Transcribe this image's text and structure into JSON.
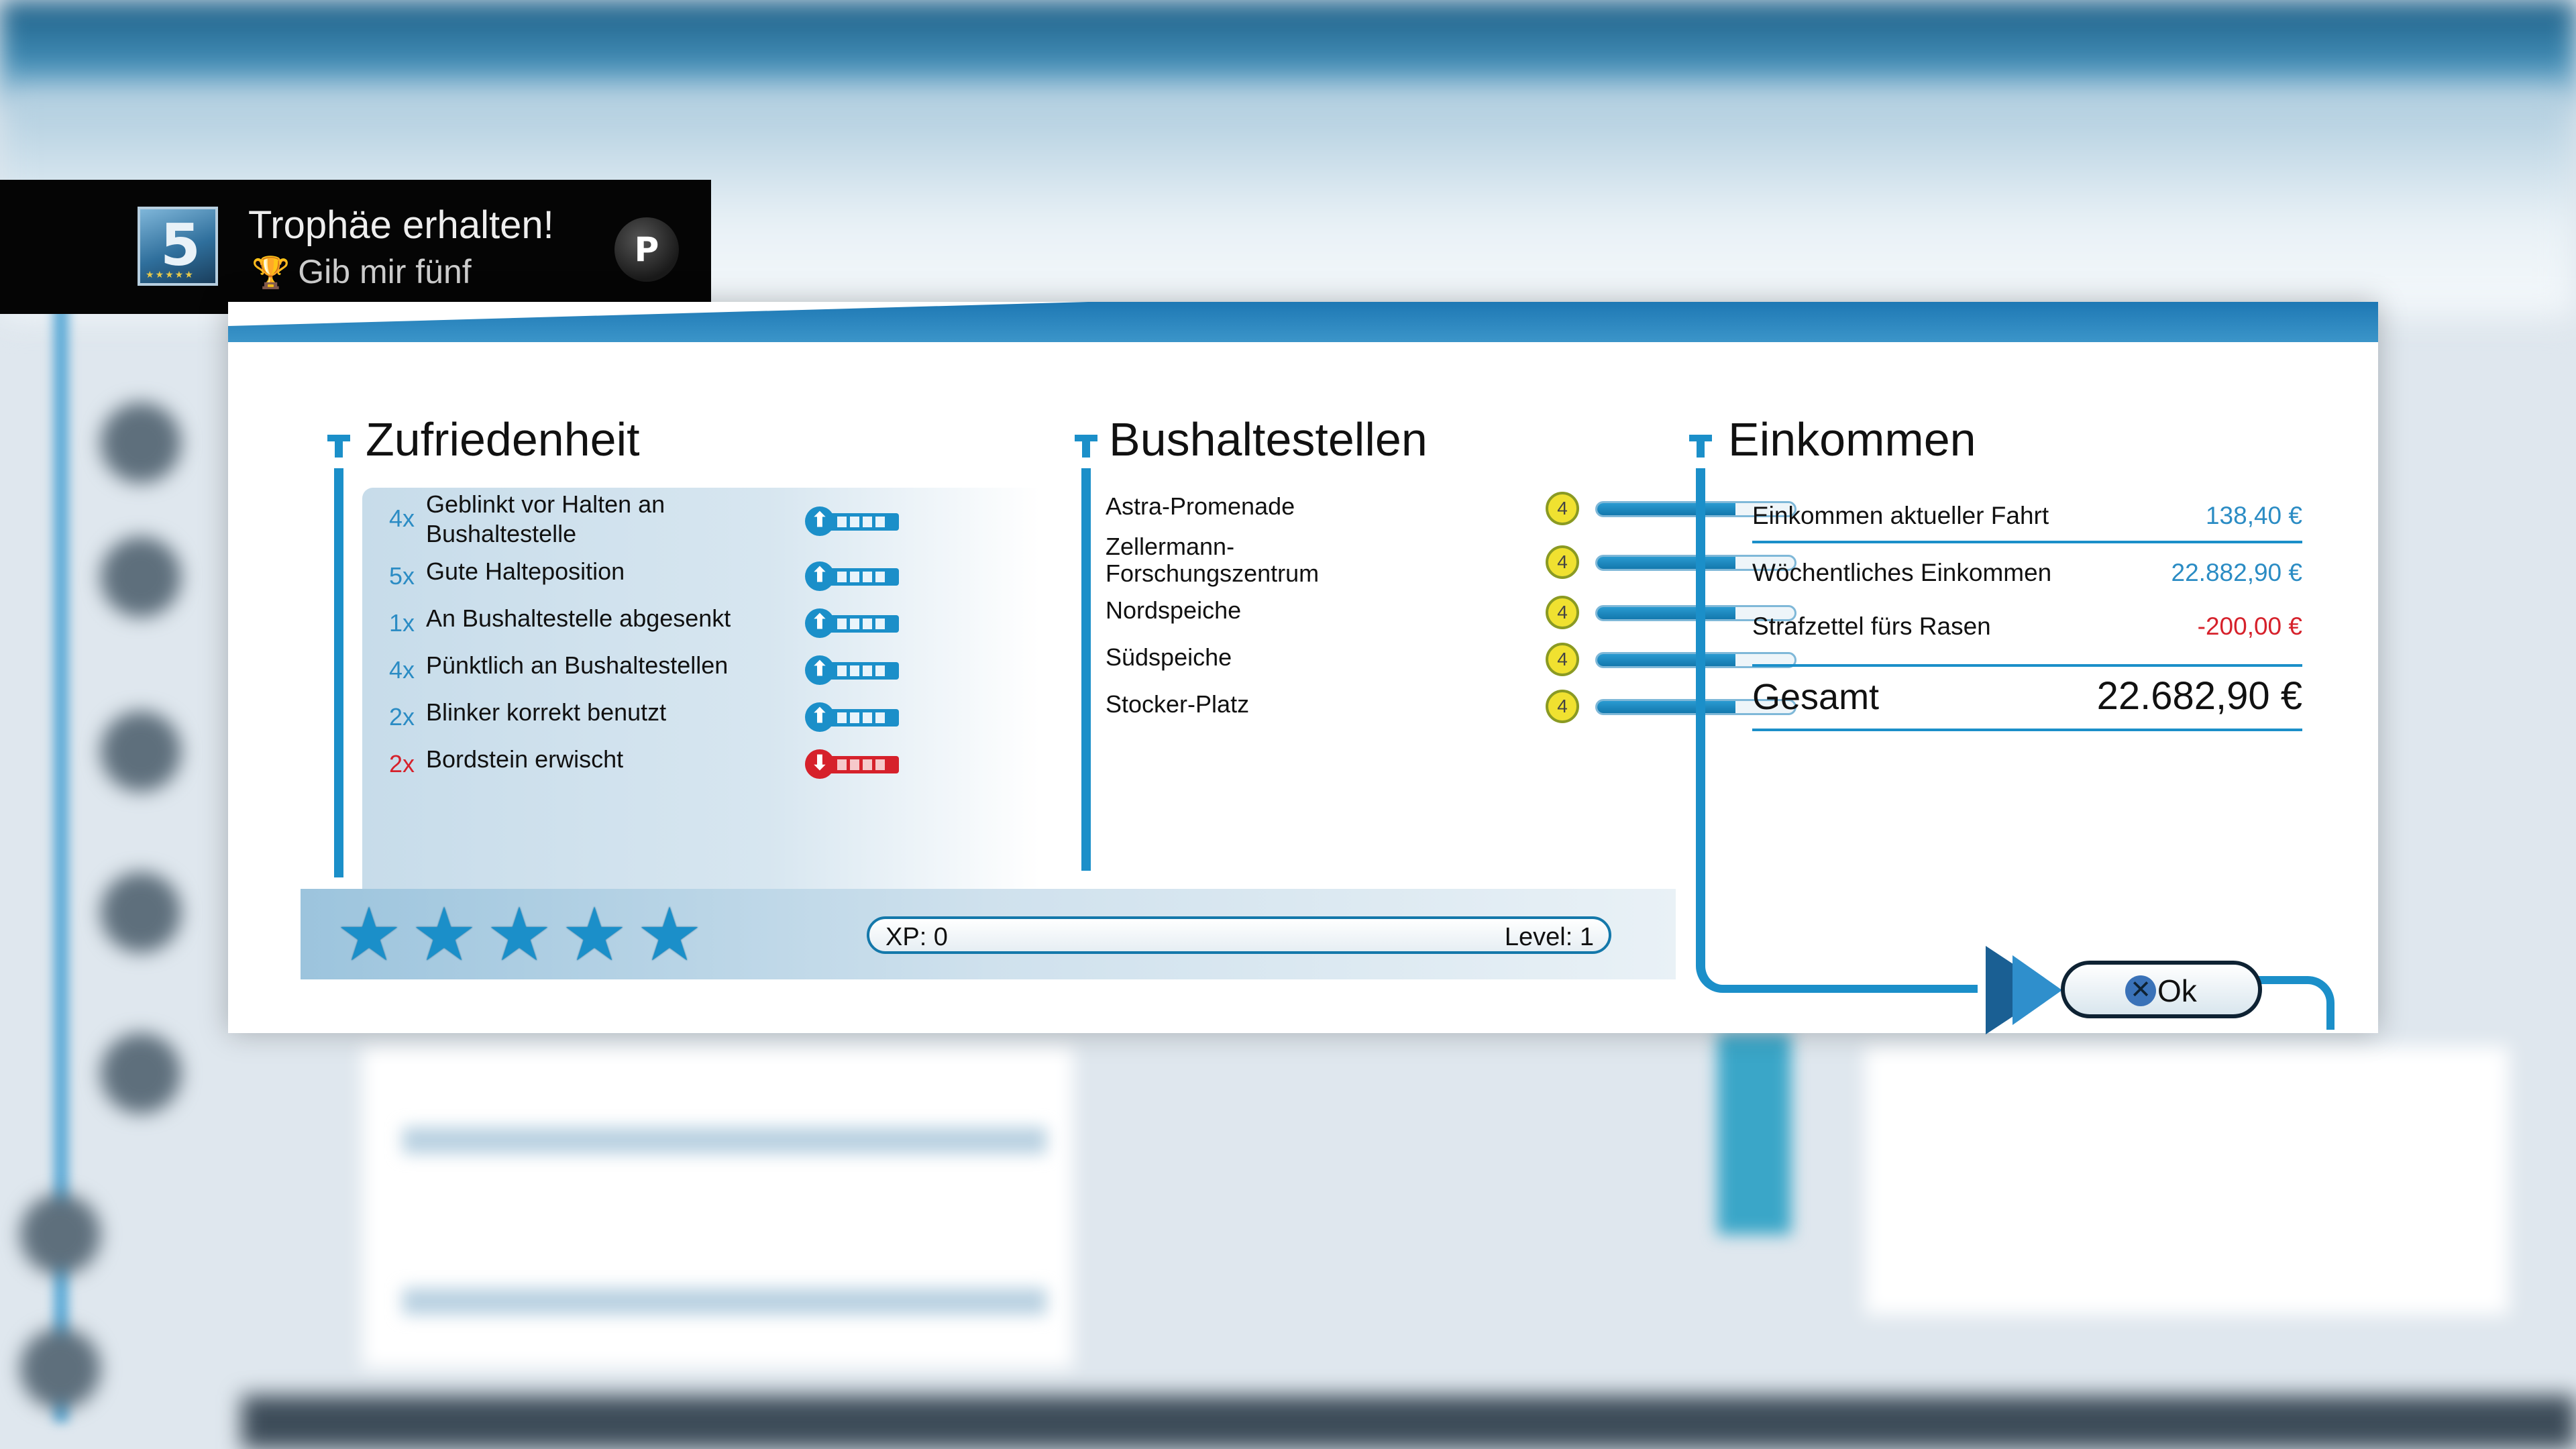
{
  "trophy": {
    "title": "Trophäe erhalten!",
    "name": "Gib mir fünf",
    "icon_number": "5",
    "icon": "trophy-cup-icon",
    "platform_icon": "playstation-logo-icon"
  },
  "satisfaction": {
    "title": "Zufriedenheit",
    "items": [
      {
        "count": "4x",
        "label": "Geblinkt vor Halten an Bushaltestelle",
        "positive": true
      },
      {
        "count": "5x",
        "label": "Gute Halteposition",
        "positive": true
      },
      {
        "count": "1x",
        "label": "An Bushaltestelle abgesenkt",
        "positive": true
      },
      {
        "count": "4x",
        "label": "Pünktlich an Bushaltestellen",
        "positive": true
      },
      {
        "count": "2x",
        "label": "Blinker korrekt benutzt",
        "positive": true
      },
      {
        "count": "2x",
        "label": "Bordstein erwischt",
        "positive": false
      }
    ]
  },
  "stops": {
    "title": "Bushaltestellen",
    "items": [
      {
        "name": "Astra-Promenade",
        "badge": "4",
        "fill": 0.7
      },
      {
        "name": "Zellermann-\nForschungszentrum",
        "badge": "4",
        "fill": 0.7
      },
      {
        "name": "Nordspeiche",
        "badge": "4",
        "fill": 0.7
      },
      {
        "name": "Südspeiche",
        "badge": "4",
        "fill": 0.7
      },
      {
        "name": "Stocker-Platz",
        "badge": "4",
        "fill": 0.7
      }
    ]
  },
  "income": {
    "title": "Einkommen",
    "rows": [
      {
        "label": "Einkommen aktueller Fahrt",
        "value": "138,40 €",
        "negative": false
      },
      {
        "label": "Wöchentliches Einkommen",
        "value": "22.882,90 €",
        "negative": false
      },
      {
        "label": "Strafzettel fürs Rasen",
        "value": "-200,00 €",
        "negative": true
      }
    ],
    "total_label": "Gesamt",
    "total_value": "22.682,90 €"
  },
  "rating": {
    "stars": 5,
    "max": 5
  },
  "progress": {
    "xp_label": "XP: 0",
    "level_label": "Level: 1"
  },
  "ok_button": {
    "label": "Ok",
    "icon": "cross-button-icon"
  },
  "colors": {
    "accent": "#1b8fc9",
    "negative": "#d6212b",
    "badge": "#f0e130"
  }
}
